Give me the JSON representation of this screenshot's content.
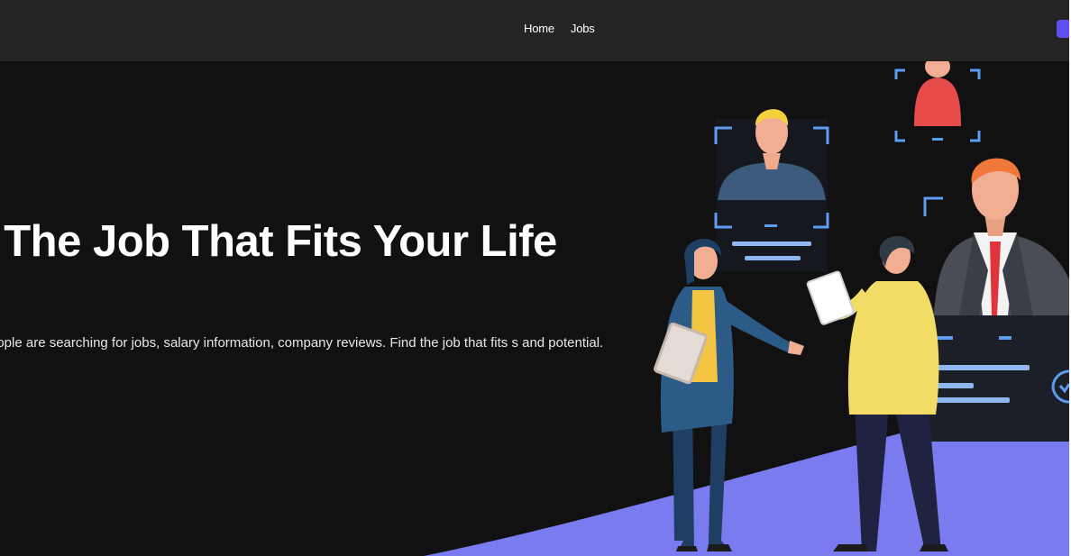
{
  "nav": {
    "links": [
      "Home",
      "Jobs"
    ]
  },
  "hero": {
    "title": "l The Job That Fits Your Life",
    "description": "eople are searching for jobs, salary information, company reviews. Find the job that fits s and potential."
  },
  "colors": {
    "background": "#111111",
    "navbar": "#252525",
    "accent": "#5d4ff0",
    "ground": "#7b7bf0"
  },
  "illustration": {
    "icon": "recruitment-illustration"
  }
}
